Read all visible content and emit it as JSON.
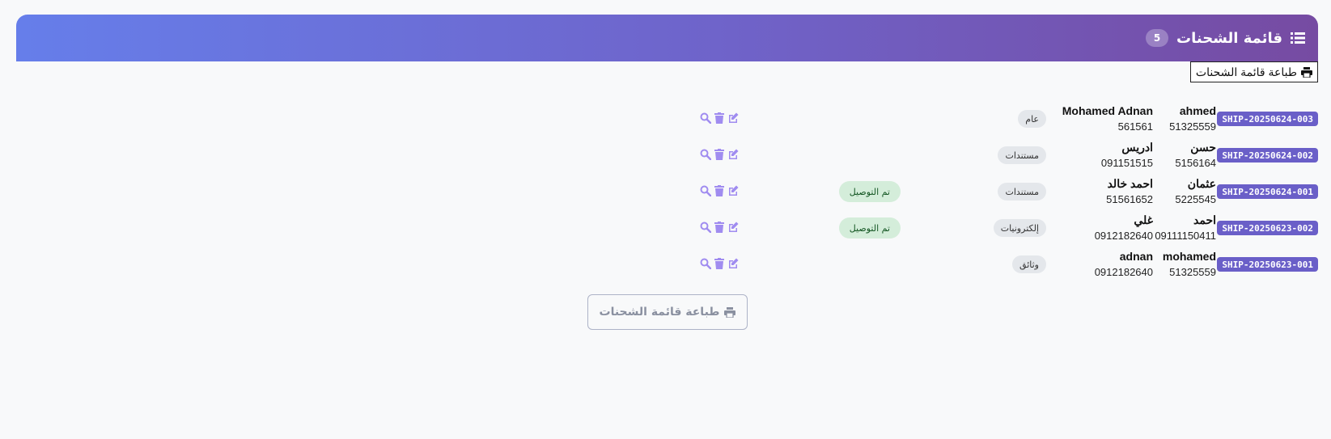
{
  "header": {
    "title": "قائمة الشحنات",
    "count": "5",
    "gradient_start": "#667eea",
    "gradient_end": "#764ba2"
  },
  "print_top_label": "طباعة قائمة الشحنات",
  "print_bottom_label": "طباعة قائمة الشحنات",
  "shipments": [
    {
      "id": "SHIP-20250624-003",
      "sender_name": "ahmed",
      "sender_phone": "51325559",
      "receiver_name": "Mohamed Adnan",
      "receiver_phone": "561561",
      "type": "عام",
      "status": ""
    },
    {
      "id": "SHIP-20250624-002",
      "sender_name": "حسن",
      "sender_phone": "5156164",
      "receiver_name": "ادريس",
      "receiver_phone": "091151515",
      "type": "مستندات",
      "status": ""
    },
    {
      "id": "SHIP-20250624-001",
      "sender_name": "عثمان",
      "sender_phone": "5225545",
      "receiver_name": "احمد خالد",
      "receiver_phone": "51561652",
      "type": "مستندات",
      "status": "تم التوصيل"
    },
    {
      "id": "SHIP-20250623-002",
      "sender_name": "احمد",
      "sender_phone": "09111150411",
      "receiver_name": "غلي",
      "receiver_phone": "0912182640",
      "type": "إلكترونيات",
      "status": "تم التوصيل"
    },
    {
      "id": "SHIP-20250623-001",
      "sender_name": "mohamed",
      "sender_phone": "51325559",
      "receiver_name": "adnan",
      "receiver_phone": "0912182640",
      "type": "وثائق",
      "status": ""
    }
  ],
  "icons": {
    "header": "list-icon",
    "print": "print-icon",
    "actions": [
      "edit-icon",
      "trash-icon",
      "search-icon"
    ]
  },
  "colors": {
    "id_badge": "#6a5fc8",
    "status_badge_bg": "#d4edda",
    "status_badge_text": "#155724",
    "action_icon": "#a08cf0"
  }
}
